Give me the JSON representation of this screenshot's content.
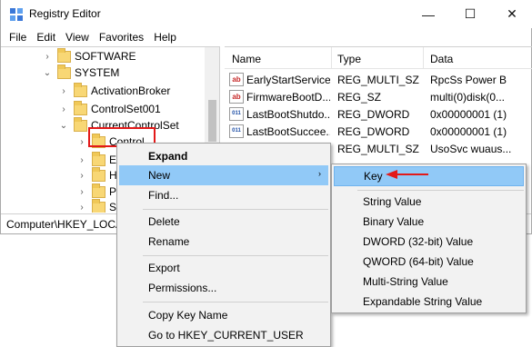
{
  "window": {
    "title": "Registry Editor",
    "controls": {
      "minimize": "—",
      "maximize": "☐",
      "close": "✕"
    }
  },
  "menu": [
    "File",
    "Edit",
    "View",
    "Favorites",
    "Help"
  ],
  "tree": {
    "items": [
      {
        "label": "SOFTWARE",
        "chevron": "›"
      },
      {
        "label": "SYSTEM",
        "chevron": "⌄"
      },
      {
        "label": "ActivationBroker",
        "chevron": "›"
      },
      {
        "label": "ControlSet001",
        "chevron": "›"
      },
      {
        "label": "CurrentControlSet",
        "chevron": "⌄"
      },
      {
        "label": "Control",
        "chevron": "›"
      },
      {
        "label": "E",
        "chevron": "›"
      },
      {
        "label": "H",
        "chevron": "›"
      },
      {
        "label": "P",
        "chevron": "›"
      },
      {
        "label": "S",
        "chevron": "›"
      }
    ]
  },
  "list": {
    "columns": [
      "Name",
      "Type",
      "Data"
    ],
    "rows": [
      {
        "icon": "ab",
        "name": "EarlyStartServices",
        "type": "REG_MULTI_SZ",
        "data": "RpcSs Power B"
      },
      {
        "icon": "ab",
        "name": "FirmwareBootD...",
        "type": "REG_SZ",
        "data": "multi(0)disk(0..."
      },
      {
        "icon": "011",
        "name": "LastBootShutdo...",
        "type": "REG_DWORD",
        "data": "0x00000001 (1)"
      },
      {
        "icon": "011",
        "name": "LastBootSuccee...",
        "type": "REG_DWORD",
        "data": "0x00000001 (1)"
      },
      {
        "icon": "",
        "name": "",
        "type": "REG_MULTI_SZ",
        "data": "UsoSvc wuaus..."
      }
    ]
  },
  "status": {
    "path": "Computer\\HKEY_LOCA"
  },
  "context_menu": {
    "expand": "Expand",
    "new": "New",
    "new_arrow": "›",
    "find": "Find...",
    "delete": "Delete",
    "rename": "Rename",
    "export": "Export",
    "permissions": "Permissions...",
    "copy_key_name": "Copy Key Name",
    "goto": "Go to HKEY_CURRENT_USER"
  },
  "submenu": {
    "key": "Key",
    "string_value": "String Value",
    "binary_value": "Binary Value",
    "dword": "DWORD (32-bit) Value",
    "qword": "QWORD (64-bit) Value",
    "multi_string": "Multi-String Value",
    "expandable_string": "Expandable String Value"
  },
  "colors": {
    "hover": "#91c9f7",
    "annotation": "#e31919",
    "folder": "#f8d775"
  }
}
